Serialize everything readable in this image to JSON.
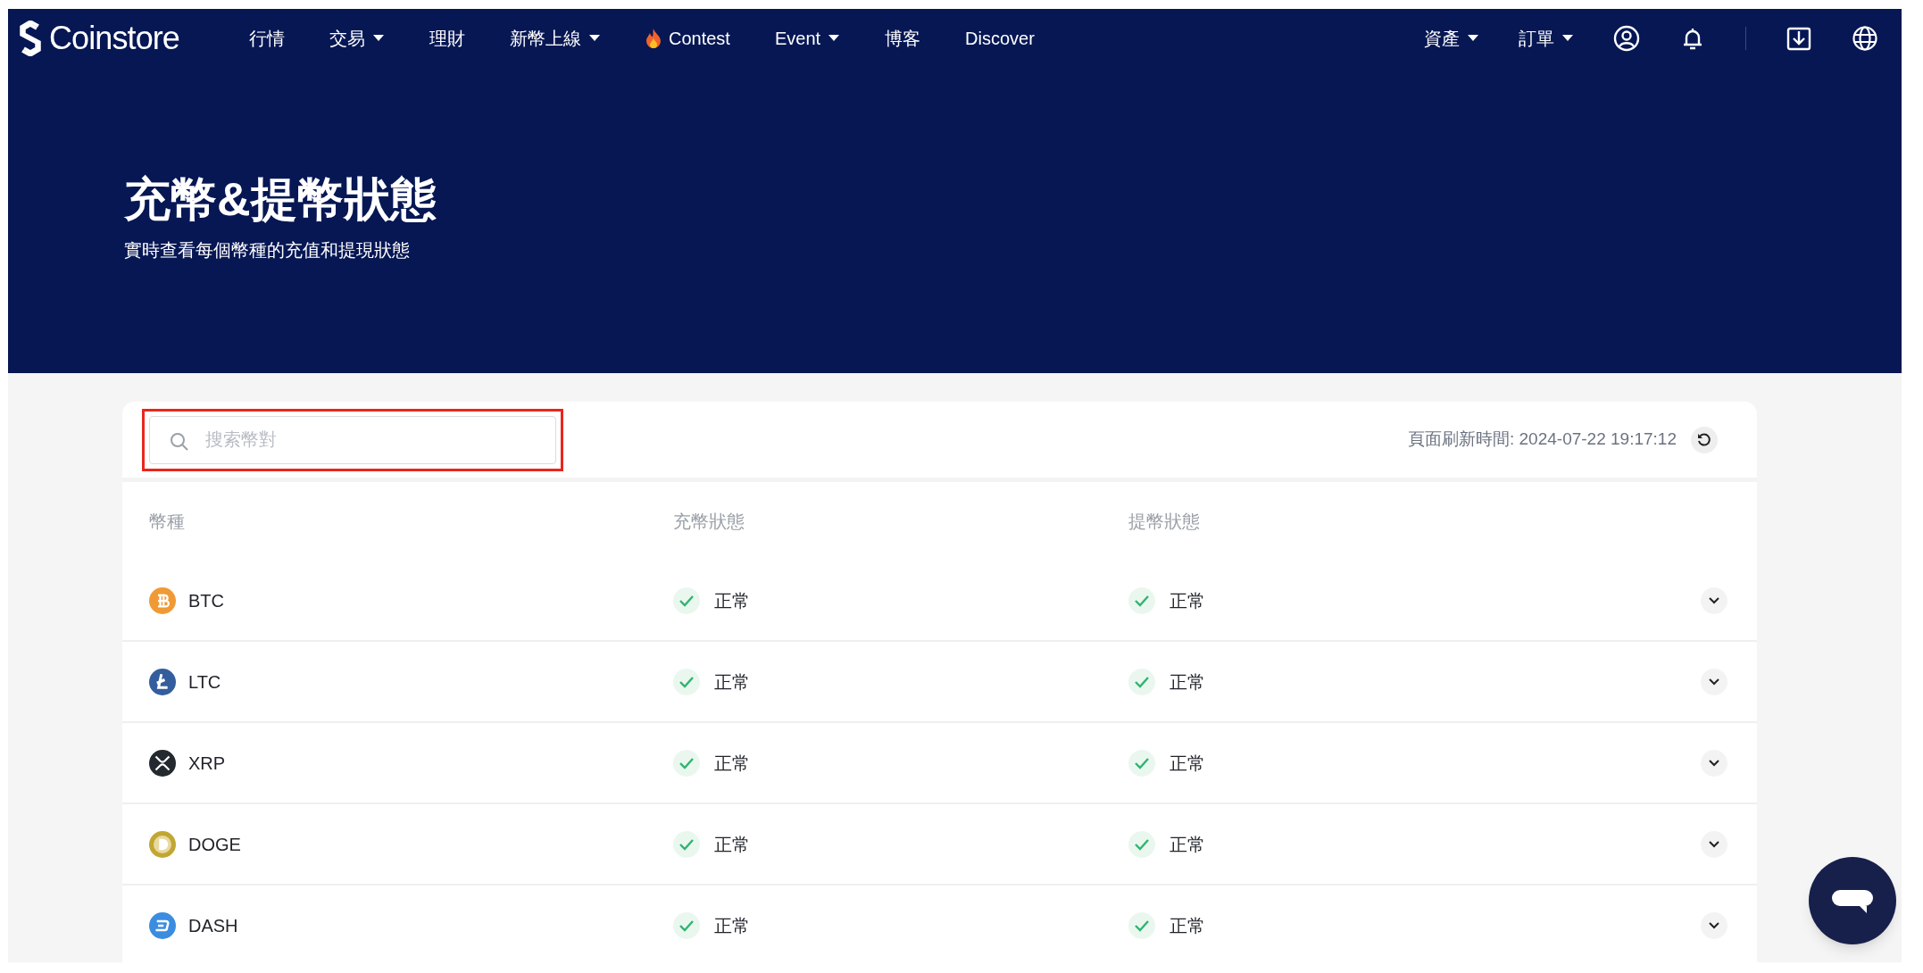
{
  "nav": {
    "logo": "Coinstore",
    "items": [
      {
        "label": "行情",
        "kind": "plain"
      },
      {
        "label": "交易",
        "kind": "dropdown"
      },
      {
        "label": "理財",
        "kind": "plain"
      },
      {
        "label": "新幣上線",
        "kind": "dropdown"
      },
      {
        "label": "Contest",
        "kind": "flame"
      },
      {
        "label": "Event",
        "kind": "dropdown"
      },
      {
        "label": "博客",
        "kind": "plain"
      },
      {
        "label": "Discover",
        "kind": "plain"
      }
    ],
    "right_items": [
      {
        "label": "資產",
        "kind": "dropdown"
      },
      {
        "label": "訂單",
        "kind": "dropdown"
      }
    ]
  },
  "hero": {
    "title": "充幣&提幣狀態",
    "subtitle": "實時查看每個幣種的充值和提現狀態"
  },
  "search": {
    "placeholder": "搜索幣對",
    "highlighted": true
  },
  "refresh_time": "頁面刷新時間: 2024-07-22 19:17:12",
  "table": {
    "columns": [
      "幣種",
      "充幣狀態",
      "提幣狀態"
    ],
    "rows": [
      {
        "coin": "BTC",
        "kind": "btc",
        "color": "#f09a36",
        "deposit": {
          "text": "正常",
          "ok": true
        },
        "withdraw": {
          "text": "正常",
          "ok": true
        },
        "expanded": false
      },
      {
        "coin": "LTC",
        "kind": "ltc",
        "color": "#345d9d",
        "deposit": {
          "text": "正常",
          "ok": true
        },
        "withdraw": {
          "text": "正常",
          "ok": true
        },
        "expanded": false
      },
      {
        "coin": "XRP",
        "kind": "xrp",
        "color": "#23292f",
        "deposit": {
          "text": "正常",
          "ok": true
        },
        "withdraw": {
          "text": "正常",
          "ok": true
        },
        "expanded": false
      },
      {
        "coin": "DOGE",
        "kind": "doge",
        "color": "#c2a633",
        "deposit": {
          "text": "正常",
          "ok": true
        },
        "withdraw": {
          "text": "正常",
          "ok": true
        },
        "expanded": false
      },
      {
        "coin": "DASH",
        "kind": "dash",
        "color": "#3b8de0",
        "deposit": {
          "text": "正常",
          "ok": true
        },
        "withdraw": {
          "text": "正常",
          "ok": true
        },
        "expanded": false
      }
    ]
  }
}
